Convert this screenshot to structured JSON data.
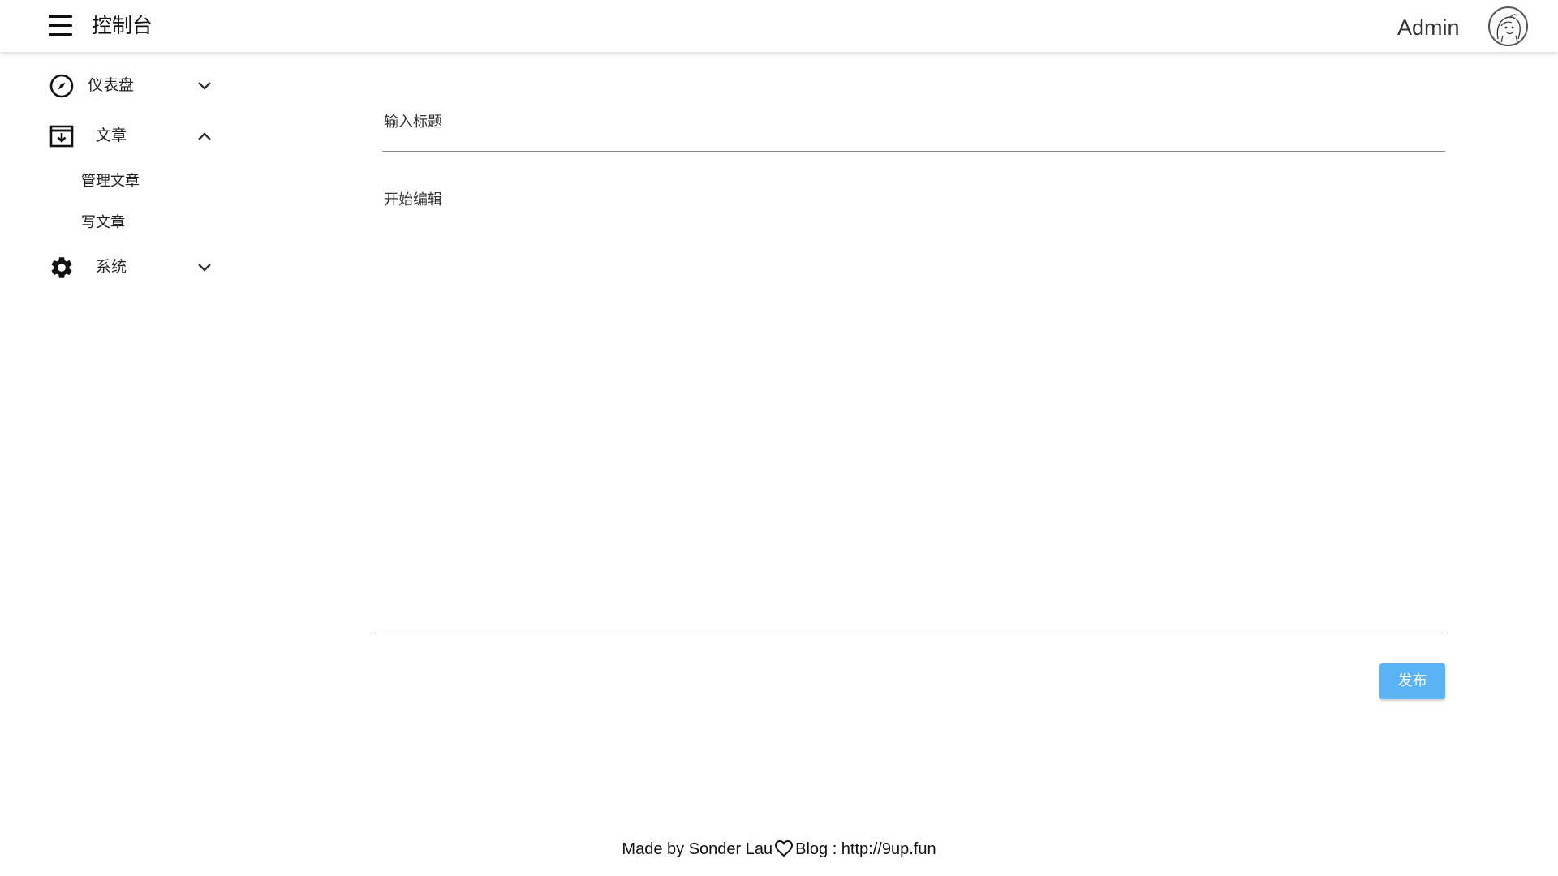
{
  "header": {
    "title": "控制台",
    "user_name": "Admin",
    "icons": {
      "menu": "menu-icon",
      "avatar": "avatar-icon"
    }
  },
  "sidebar": {
    "items": [
      {
        "label": "仪表盘",
        "icon": "compass-icon",
        "expanded": false
      },
      {
        "label": "文章",
        "icon": "archive-download-icon",
        "expanded": true,
        "children": [
          {
            "label": "管理文章"
          },
          {
            "label": "写文章"
          }
        ]
      },
      {
        "label": "系统",
        "icon": "gear-icon",
        "expanded": false
      }
    ]
  },
  "editor": {
    "title_placeholder": "输入标题",
    "content_placeholder": "开始编辑",
    "publish_label": "发布"
  },
  "footer": {
    "made_by": "Made by Sonder Lau",
    "blog": "Blog : http://9up.fun"
  },
  "colors": {
    "accent": "#5ab3f5",
    "text": "#222222",
    "divider": "#888888"
  }
}
